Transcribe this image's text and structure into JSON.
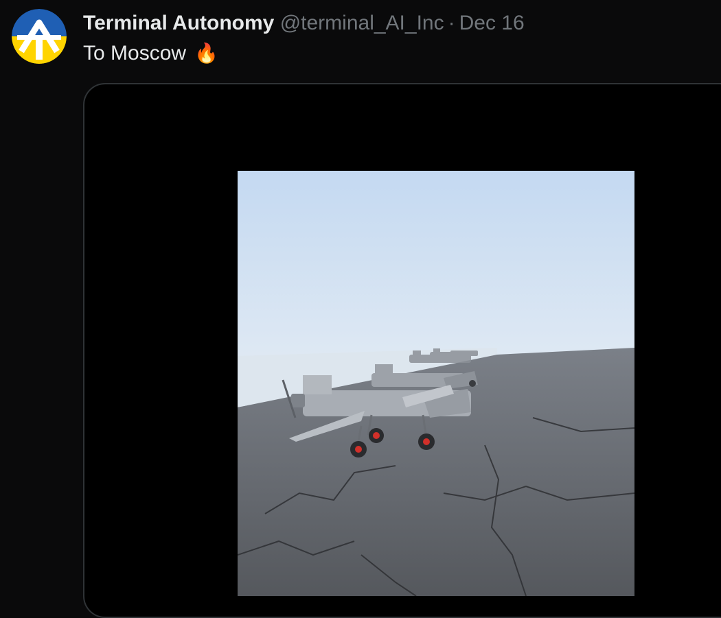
{
  "tweet": {
    "author": {
      "display_name": "Terminal Autonomy",
      "handle": "@terminal_AI_Inc",
      "avatar_icon": "terminal-autonomy-logo-icon",
      "avatar_colors": {
        "top": "#1f5fb4",
        "bottom": "#ffd400",
        "mark": "#ffffff"
      }
    },
    "separator": "·",
    "date": "Dec 16",
    "text": "To Moscow",
    "emoji": "🔥",
    "emoji_icon": "fire-icon",
    "media": {
      "type": "video",
      "icon": "drone-row-photo"
    }
  }
}
